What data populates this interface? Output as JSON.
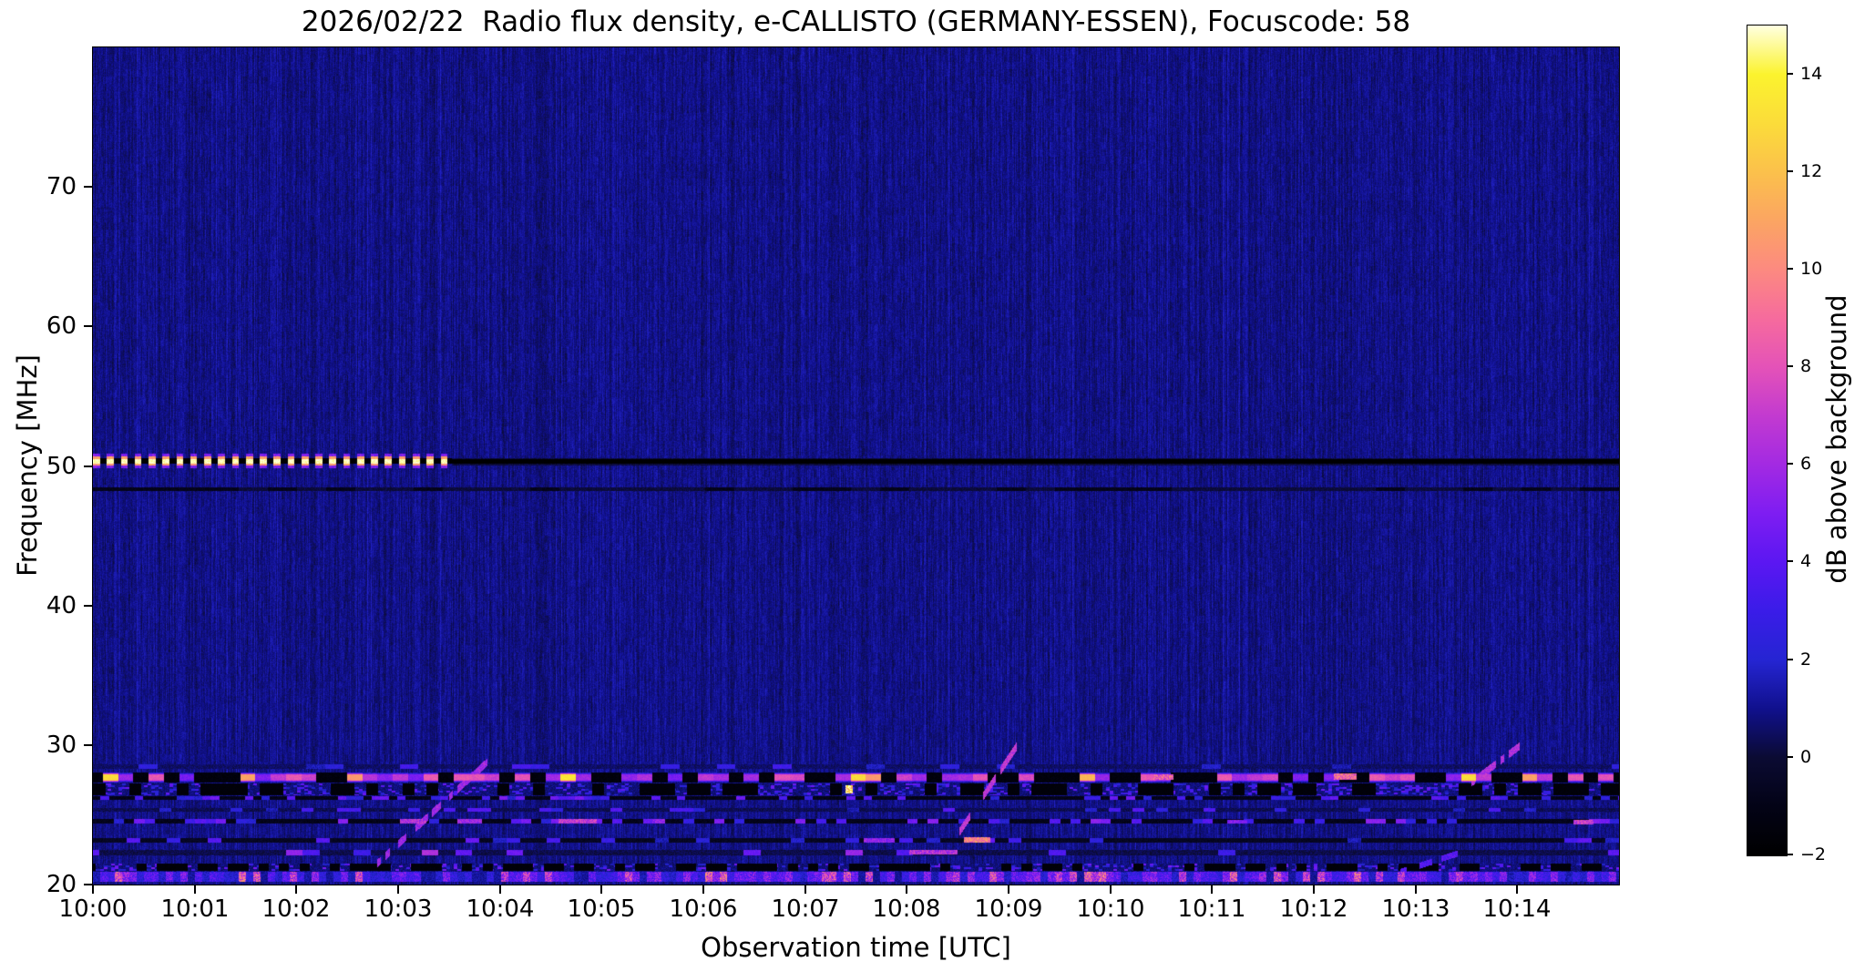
{
  "title": "2026/02/22  Radio flux density, e-CALLISTO (GERMANY-ESSEN), Focuscode: 58",
  "chart_data": {
    "type": "heatmap",
    "subtype": "radio-spectrogram",
    "title": "2026/02/22  Radio flux density, e-CALLISTO (GERMANY-ESSEN), Focuscode: 58",
    "xlabel": "Observation time [UTC]",
    "ylabel": "Frequency [MHz]",
    "x_axis": {
      "label": "Observation time [UTC]",
      "ticks": [
        "10:00",
        "10:01",
        "10:02",
        "10:03",
        "10:04",
        "10:05",
        "10:06",
        "10:07",
        "10:08",
        "10:09",
        "10:10",
        "10:11",
        "10:12",
        "10:13",
        "10:14"
      ],
      "tick_minutes": [
        0,
        1,
        2,
        3,
        4,
        5,
        6,
        7,
        8,
        9,
        10,
        11,
        12,
        13,
        14
      ]
    },
    "x_range_minutes": [
      0,
      15
    ],
    "y_axis": {
      "label": "Frequency [MHz]",
      "ticks": [
        70,
        60,
        50,
        40,
        30,
        20
      ]
    },
    "ylim": [
      20,
      80
    ],
    "grid": false,
    "colorbar": {
      "label": "dB above background",
      "ticks": [
        14,
        12,
        10,
        8,
        6,
        4,
        2,
        0,
        -2
      ],
      "vmin": -2,
      "vmax": 15
    },
    "colormap_stops": [
      [
        0.0,
        "#000000"
      ],
      [
        0.059,
        "#030316"
      ],
      [
        0.118,
        "#0b0b33"
      ],
      [
        0.176,
        "#10108c"
      ],
      [
        0.235,
        "#2525d2"
      ],
      [
        0.294,
        "#3a1ce8"
      ],
      [
        0.353,
        "#5b17f2"
      ],
      [
        0.412,
        "#7e1df2"
      ],
      [
        0.471,
        "#a32ae2"
      ],
      [
        0.529,
        "#c23ad0"
      ],
      [
        0.588,
        "#e452b8"
      ],
      [
        0.647,
        "#f66b9d"
      ],
      [
        0.706,
        "#fc8a80"
      ],
      [
        0.765,
        "#fba562"
      ],
      [
        0.824,
        "#fbc14b"
      ],
      [
        0.882,
        "#fbdc3a"
      ],
      [
        0.941,
        "#fbf32e"
      ],
      [
        1.0,
        "#ffffe0"
      ]
    ],
    "background_db": 0.92,
    "features": {
      "beacon": {
        "description": "periodic bright pulses on 50.35 MHz from 10:00:00 until ~10:03:32",
        "f_center": 50.35,
        "h_core": 0.17,
        "h_mid": 0.33,
        "h_halo": 0.5,
        "t_end_min": 3.53,
        "period_s": 8.2,
        "duty": 0.5,
        "v_core": 15,
        "v_mid": 10.5,
        "v_halo": 4.5,
        "v_gap": -2
      },
      "notch_50mhz": {
        "description": "black interference-free line after beacon stops",
        "f_center": 50.32,
        "h": 0.14,
        "v": -2,
        "t_start_min": 3.53
      },
      "faint_line_48mhz": {
        "f_center": 48.35,
        "h": 0.12,
        "v": -0.3
      },
      "rfi_bands": [
        {
          "f_top": 28.62,
          "f_bot": 28.3,
          "type": "dashline",
          "v_dark": 0.4,
          "p_dash": 0.18,
          "v_dash": [
            1.5,
            3.5
          ],
          "seg_s": 11
        },
        {
          "f_top": 28.05,
          "f_bot": 27.3,
          "type": "alt",
          "seg_s": 9,
          "p_bright": 0.52,
          "v_bright": [
            4.5,
            8.5
          ],
          "v_hot_prob": 0.14,
          "v_hot": [
            9,
            13.5
          ],
          "v_off": -1.75
        },
        {
          "f_top": 27.25,
          "f_bot": 26.4,
          "type": "blocks",
          "seg_s": 7,
          "p_black": 0.42,
          "v_speckle": [
            1.5,
            4.5
          ]
        },
        {
          "f_top": 26.35,
          "f_bot": 26.05,
          "type": "dashline",
          "v_dark": -1.1,
          "p_dash": 0.3,
          "v_dash": [
            2,
            5
          ],
          "seg_s": 5
        },
        {
          "f_top": 25.5,
          "f_bot": 25.2,
          "type": "dashline",
          "v_dark": 0.2,
          "p_dash": 0.22,
          "v_dash": [
            1.5,
            4
          ],
          "seg_s": 7
        },
        {
          "f_top": 24.72,
          "f_bot": 24.38,
          "type": "dashline",
          "v_dark": -1.0,
          "p_dash": 0.32,
          "v_dash": [
            2,
            5.5
          ],
          "seg_s": 6
        },
        {
          "f_top": 23.32,
          "f_bot": 23.02,
          "type": "dashline",
          "v_dark": -0.7,
          "p_dash": 0.22,
          "v_dash": [
            1.5,
            4.5
          ],
          "seg_s": 8
        },
        {
          "f_top": 22.5,
          "f_bot": 22.12,
          "type": "dashline",
          "v_dark": 0.1,
          "p_dash": 0.16,
          "v_dash": [
            3,
            6.5
          ],
          "seg_s": 10
        },
        {
          "f_top": 21.52,
          "f_bot": 20.95,
          "type": "blocks",
          "seg_s": 6,
          "p_black": 0.52,
          "v_speckle": [
            1.5,
            5
          ]
        },
        {
          "f_top": 20.92,
          "f_bot": 20.18,
          "type": "speckle",
          "v": [
            1.5,
            7.5
          ],
          "v_hot_prob": 0.16,
          "v_hot": [
            8,
            11.5
          ]
        }
      ],
      "streaks": [
        {
          "t0": 2.78,
          "f0": 21.4,
          "t1": 3.97,
          "f1": 29.4,
          "v": 5.5,
          "w": 0.28,
          "dotted": true
        },
        {
          "t0": 8.52,
          "f0": 23.8,
          "t1": 9.08,
          "f1": 29.9,
          "v": 6.5,
          "w": 0.3,
          "dotted": true
        },
        {
          "t0": 13.55,
          "f0": 27.3,
          "t1": 14.02,
          "f1": 29.9,
          "v": 6.0,
          "w": 0.28,
          "dotted": true
        },
        {
          "t0": 12.85,
          "f0": 20.9,
          "t1": 13.45,
          "f1": 22.3,
          "v": 3.5,
          "w": 0.22,
          "dotted": true
        }
      ],
      "events": [
        {
          "t0": 3.02,
          "t1": 3.28,
          "f": 24.55,
          "h": 0.16,
          "v": 6.5
        },
        {
          "t0": 3.58,
          "t1": 3.82,
          "f": 24.55,
          "h": 0.16,
          "v": 6.0
        },
        {
          "t0": 4.58,
          "t1": 4.95,
          "f": 24.55,
          "h": 0.17,
          "v": 7.0
        },
        {
          "t0": 5.5,
          "t1": 5.62,
          "f": 24.55,
          "h": 0.15,
          "v": 5.5
        },
        {
          "t0": 7.58,
          "t1": 7.88,
          "f": 23.15,
          "h": 0.17,
          "v": 5.5
        },
        {
          "t0": 8.02,
          "t1": 8.5,
          "f": 22.3,
          "h": 0.17,
          "v": 6.5
        },
        {
          "t0": 8.56,
          "t1": 8.82,
          "f": 23.2,
          "h": 0.18,
          "v": 9.5
        },
        {
          "t0": 7.4,
          "t1": 7.47,
          "f": 26.8,
          "h": 0.3,
          "v": 13.0
        },
        {
          "t0": 10.42,
          "t1": 10.62,
          "f": 27.7,
          "h": 0.22,
          "v": 8.5
        },
        {
          "t0": 12.2,
          "t1": 12.42,
          "f": 27.75,
          "h": 0.22,
          "v": 9.0
        },
        {
          "t0": 11.15,
          "t1": 11.35,
          "f": 24.5,
          "h": 0.15,
          "v": 5.0
        },
        {
          "t0": 14.55,
          "t1": 14.75,
          "f": 24.5,
          "h": 0.16,
          "v": 7.0
        }
      ]
    }
  }
}
